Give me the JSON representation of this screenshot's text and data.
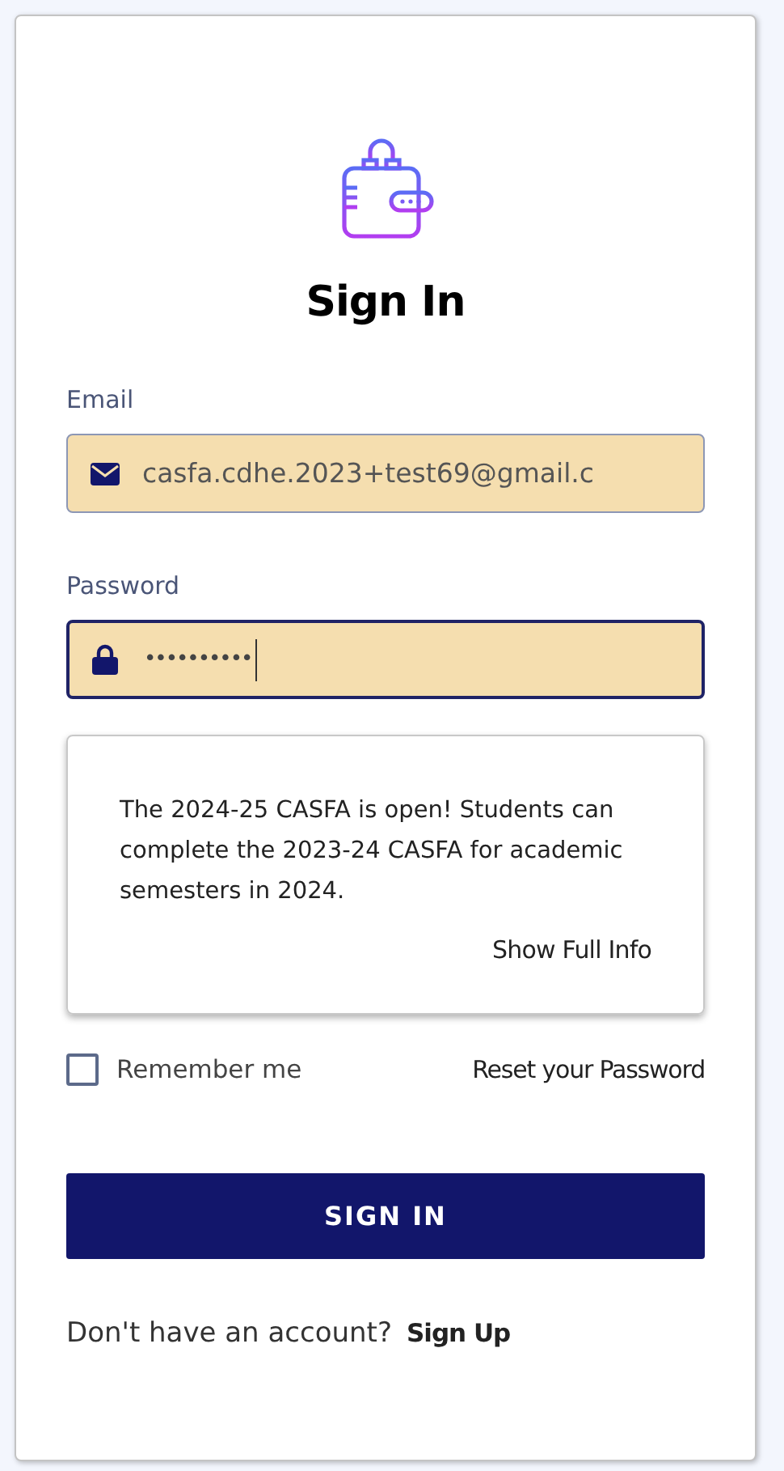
{
  "title": "Sign In",
  "fields": [
    {
      "label": "Email",
      "kind": "email",
      "value": "casfa.cdhe.2023+test69@gmail.c",
      "focused": false
    },
    {
      "label": "Password",
      "kind": "password",
      "value": "••••••••••",
      "focused": true
    }
  ],
  "notice": {
    "text": "The 2024-25 CASFA is open! Students can complete the 2023-24 CASFA for academic semesters in 2024.",
    "link": "Show Full Info"
  },
  "remember": {
    "label": "Remember me",
    "checked": false
  },
  "reset_link": "Reset your Password",
  "submit": "SIGN IN",
  "signup": {
    "prompt": "Don't have an account?",
    "link": "Sign Up"
  }
}
